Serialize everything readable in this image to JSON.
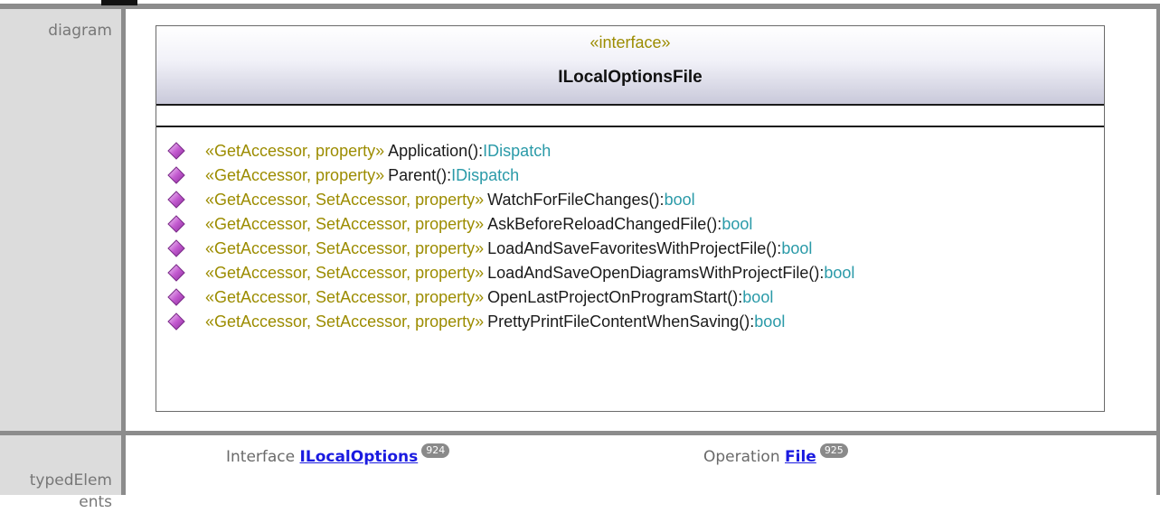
{
  "labels": {
    "diagram": "diagram",
    "typed_elements": "typedElem\nents"
  },
  "uml": {
    "stereotype": "«interface»",
    "name": "ILocalOptionsFile",
    "operations": [
      {
        "stereotype": "«GetAccessor, property»",
        "name": "Application()",
        "type": "IDispatch"
      },
      {
        "stereotype": "«GetAccessor, property»",
        "name": "Parent()",
        "type": "IDispatch"
      },
      {
        "stereotype": "«GetAccessor, SetAccessor, property»",
        "name": "WatchForFileChanges()",
        "type": "bool"
      },
      {
        "stereotype": "«GetAccessor, SetAccessor, property»",
        "name": "AskBeforeReloadChangedFile()",
        "type": "bool"
      },
      {
        "stereotype": "«GetAccessor, SetAccessor, property»",
        "name": "LoadAndSaveFavoritesWithProjectFile()",
        "type": "bool"
      },
      {
        "stereotype": "«GetAccessor, SetAccessor, property»",
        "name": "LoadAndSaveOpenDiagramsWithProjectFile()",
        "type": "bool"
      },
      {
        "stereotype": "«GetAccessor, SetAccessor, property»",
        "name": "OpenLastProjectOnProgramStart()",
        "type": "bool"
      },
      {
        "stereotype": "«GetAccessor, SetAccessor, property»",
        "name": "PrettyPrintFileContentWhenSaving()",
        "type": "bool"
      }
    ],
    "colors": {
      "stereotype": "#9c8c00",
      "type": "#2a9aa8",
      "operation_icon": "#c35bd0"
    }
  },
  "typed_elements": [
    {
      "kind": "Interface",
      "link": "ILocalOptions",
      "page": "924"
    },
    {
      "kind": "Operation",
      "link": "File",
      "page": "925"
    }
  ]
}
